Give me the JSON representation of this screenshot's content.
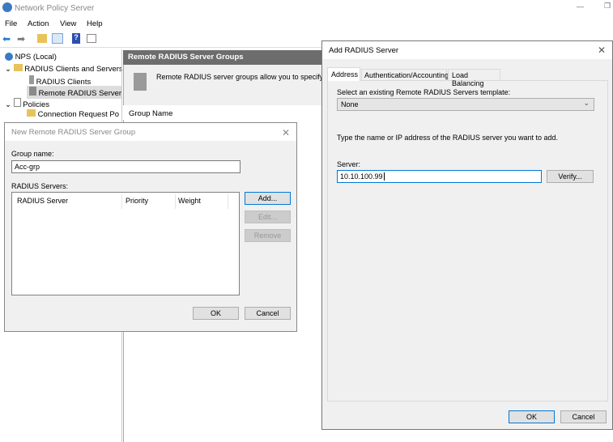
{
  "app": {
    "title": "Network Policy Server",
    "menu": [
      "File",
      "Action",
      "View",
      "Help"
    ]
  },
  "tree": {
    "root": "NPS (Local)",
    "items": [
      "RADIUS Clients and Servers",
      "RADIUS Clients",
      "Remote RADIUS Server",
      "Policies",
      "Connection Request Po"
    ]
  },
  "right": {
    "header": "Remote RADIUS Server Groups",
    "description": "Remote RADIUS server groups allow you to specify wh",
    "column": "Group Name"
  },
  "group_dialog": {
    "title": "New Remote RADIUS Server Group",
    "group_name_label": "Group name:",
    "group_name_value": "Acc-grp",
    "servers_label": "RADIUS Servers:",
    "columns": [
      "RADIUS Server",
      "Priority",
      "Weight"
    ],
    "add": "Add...",
    "edit": "Edit...",
    "remove": "Remove",
    "ok": "OK",
    "cancel": "Cancel"
  },
  "server_dialog": {
    "title": "Add RADIUS Server",
    "tabs": [
      "Address",
      "Authentication/Accounting",
      "Load Balancing"
    ],
    "active_tab": "Address",
    "template_label": "Select an existing Remote RADIUS Servers template:",
    "template_value": "None",
    "instruction": "Type the name or IP address of the RADIUS server you want to add.",
    "server_label": "Server:",
    "server_value": "10.10.100.99",
    "verify": "Verify...",
    "ok": "OK",
    "cancel": "Cancel"
  },
  "colors": {
    "accent": "#0078d7",
    "header_bg": "#6d6d6d",
    "dialog_bg": "#f0f0f0"
  }
}
